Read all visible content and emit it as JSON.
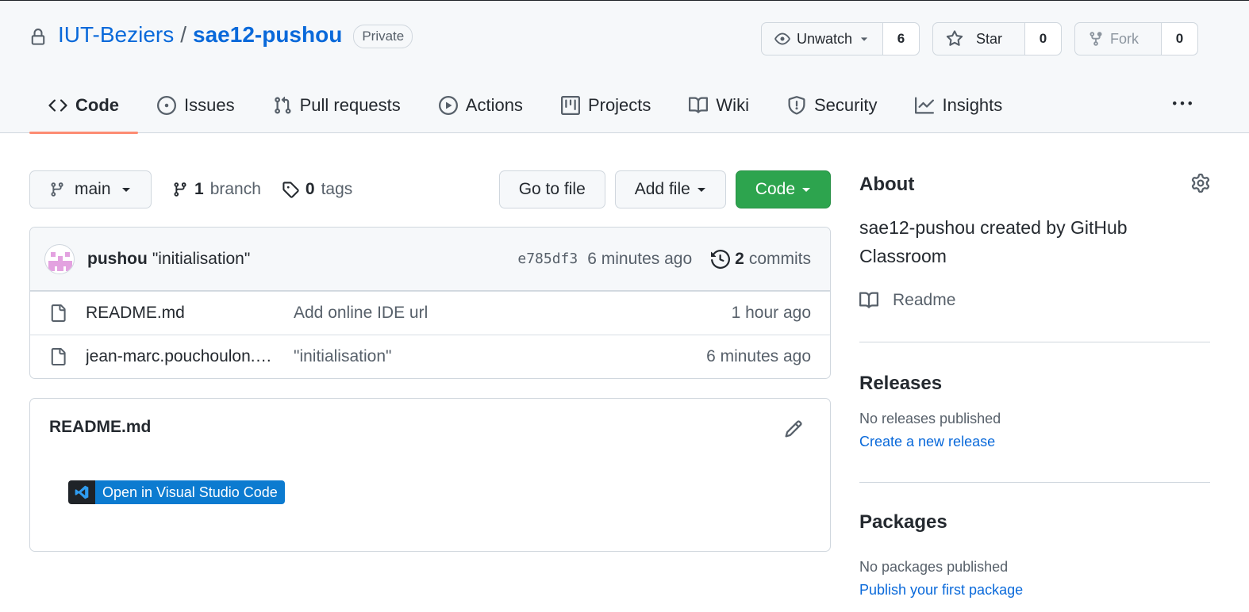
{
  "repo": {
    "owner": "IUT-Beziers",
    "separator": "/",
    "name": "sae12-pushou",
    "visibility": "Private"
  },
  "actions": {
    "watch": {
      "label": "Unwatch",
      "count": "6"
    },
    "star": {
      "label": "Star",
      "count": "0"
    },
    "fork": {
      "label": "Fork",
      "count": "0"
    }
  },
  "tabs": [
    {
      "label": "Code",
      "icon": "code-icon"
    },
    {
      "label": "Issues",
      "icon": "issue-icon"
    },
    {
      "label": "Pull requests",
      "icon": "pull-request-icon"
    },
    {
      "label": "Actions",
      "icon": "play-icon"
    },
    {
      "label": "Projects",
      "icon": "project-icon"
    },
    {
      "label": "Wiki",
      "icon": "book-icon"
    },
    {
      "label": "Security",
      "icon": "shield-icon"
    },
    {
      "label": "Insights",
      "icon": "graph-icon"
    }
  ],
  "toolbar": {
    "branch": "main",
    "branch_count": "1",
    "branch_word": "branch",
    "tag_count": "0",
    "tag_word": "tags",
    "go_to_file": "Go to file",
    "add_file": "Add file",
    "code": "Code"
  },
  "commit": {
    "author": "pushou",
    "message": "\"initialisation\"",
    "sha": "e785df3",
    "age": "6 minutes ago",
    "count": "2",
    "count_word": "commits"
  },
  "files": [
    {
      "name": "README.md",
      "message": "Add online IDE url",
      "age": "1 hour ago"
    },
    {
      "name": "jean-marc.pouchoulon.…",
      "message": "\"initialisation\"",
      "age": "6 minutes ago"
    }
  ],
  "readme": {
    "title": "README.md",
    "badge": "Open in Visual Studio Code"
  },
  "about": {
    "title": "About",
    "description": "sae12-pushou created by GitHub Classroom",
    "readme_link": "Readme"
  },
  "releases": {
    "title": "Releases",
    "empty": "No releases published",
    "link": "Create a new release"
  },
  "packages": {
    "title": "Packages",
    "empty": "No packages published",
    "link": "Publish your first package"
  },
  "colors": {
    "accent_link": "#0969da",
    "code_button": "#2da44e",
    "tab_underline": "#fd8c73",
    "vscode_badge": "#0c7bd0"
  }
}
